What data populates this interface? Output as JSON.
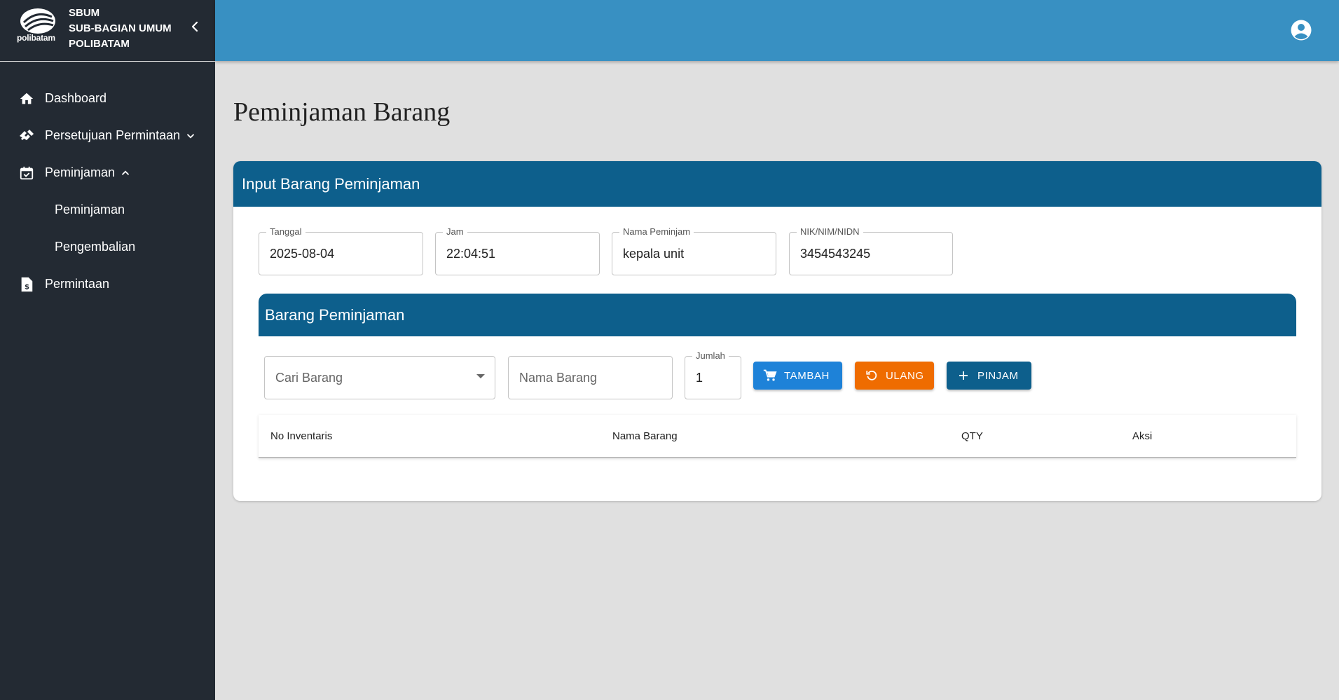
{
  "sidebar": {
    "logo_text": "polibatam",
    "brand_line1": "SBUM",
    "brand_line2": "SUB-BAGIAN UMUM",
    "brand_line3": "POLIBATAM",
    "items": [
      {
        "label": "Dashboard",
        "icon": "home-icon"
      },
      {
        "label": "Persetujuan Permintaan",
        "icon": "handshake-icon"
      },
      {
        "label": "Peminjaman",
        "icon": "calendar-check-icon"
      },
      {
        "label": "Peminjaman"
      },
      {
        "label": "Pengembalian"
      },
      {
        "label": "Permintaan",
        "icon": "document-money-icon"
      }
    ]
  },
  "header": {
    "account_icon": "account-circle-icon"
  },
  "page": {
    "title": "Peminjaman Barang"
  },
  "card": {
    "title": "Input Barang Peminjaman",
    "fields": {
      "tanggal": {
        "label": "Tanggal",
        "value": "2025-08-04"
      },
      "jam": {
        "label": "Jam",
        "value": "22:04:51"
      },
      "nama_peminjam": {
        "label": "Nama Peminjam",
        "value": "kepala unit"
      },
      "nik": {
        "label": "NIK/NIM/NIDN",
        "value": "3454543245"
      }
    },
    "section_title": "Barang Peminjaman",
    "cari_barang_placeholder": "Cari Barang",
    "nama_barang_placeholder": "Nama Barang",
    "jumlah": {
      "label": "Jumlah",
      "value": "1"
    },
    "buttons": {
      "tambah": "TAMBAH",
      "ulang": "ULANG",
      "pinjam": "PINJAM"
    },
    "table_columns": [
      "No Inventaris",
      "Nama Barang",
      "QTY",
      "Aksi"
    ]
  },
  "colors": {
    "sidebar": "#232a33",
    "topbar": "#3890c2",
    "header": "#0d5f8c",
    "tambah": "#1e82d8",
    "ulang": "#ef6c00"
  }
}
